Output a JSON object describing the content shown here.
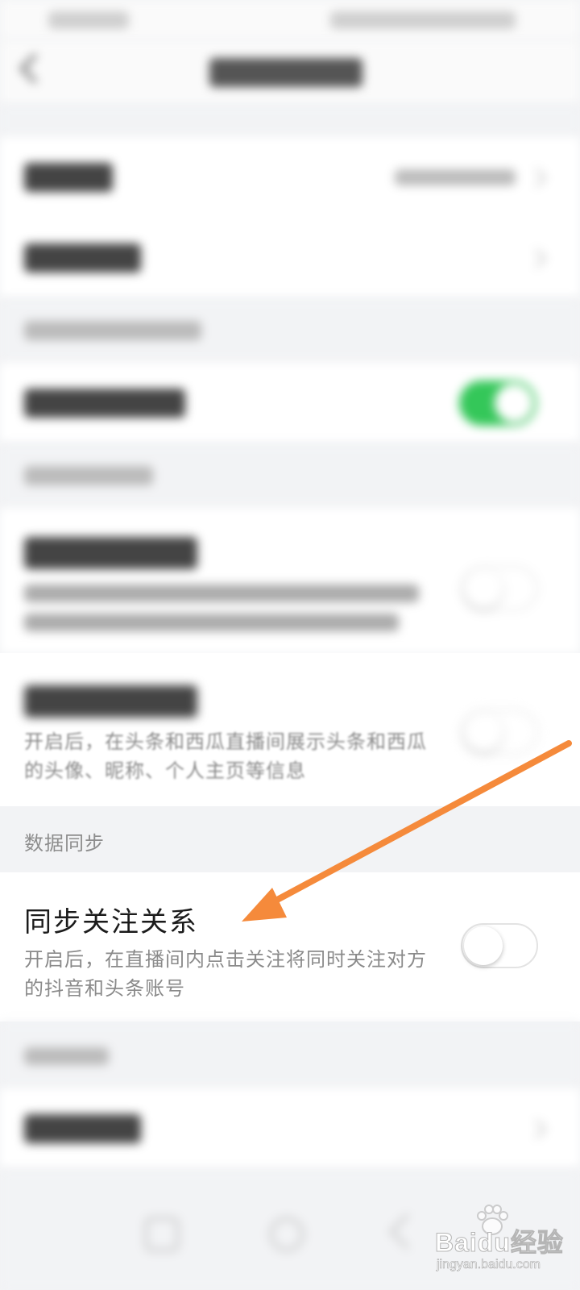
{
  "accent_color": "#f58a3b",
  "toggle_on_color": "#34c759",
  "data_sync": {
    "section_label": "数据同步",
    "follow_sync": {
      "title": "同步关注关系",
      "description": "开启后，在直播间内点击关注将同时关注对方的抖音和头条账号",
      "toggle_state": "off"
    }
  },
  "profile_sync": {
    "description": "开启后，在头条和西瓜直播间展示头条和西瓜的头像、昵称、个人主页等信息"
  },
  "watermark": {
    "brand": "Baidu经验",
    "url": "jingyan.baidu.com"
  }
}
